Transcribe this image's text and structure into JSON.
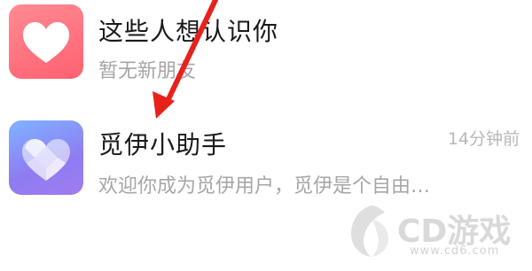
{
  "conversations": [
    {
      "name": "这些人想认识你",
      "preview": "暂无新朋友",
      "time": "",
      "avatar_icon": "heart-icon",
      "avatar_color": "#ff6d7a"
    },
    {
      "name": "觅伊小助手",
      "preview": "欢迎你成为觅伊用户，觅伊是个自由…",
      "time": "14分钟前",
      "avatar_icon": "diamond-heart-icon",
      "avatar_color": "#8f86f4"
    }
  ],
  "annotation": {
    "arrow_color": "#e8221b"
  },
  "watermark": {
    "text": "CD游戏",
    "url": "www.cd6.com"
  }
}
